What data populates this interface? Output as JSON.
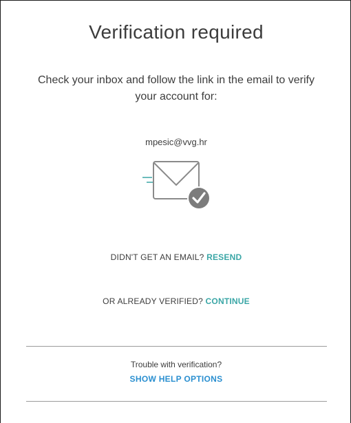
{
  "title": "Verification required",
  "instructions": "Check your inbox and follow the link in the email to verify your account for:",
  "email": "mpesic@vvg.hr",
  "envelope_icon": "envelope-check-icon",
  "resend": {
    "prompt": "DIDN'T GET AN EMAIL?",
    "link_label": "RESEND"
  },
  "continue": {
    "prompt": "OR ALREADY VERIFIED?",
    "link_label": "CONTINUE"
  },
  "help": {
    "prompt": "Trouble with verification?",
    "link_label": "SHOW HELP OPTIONS"
  },
  "colors": {
    "accent_teal": "#3aa6a6",
    "link_blue": "#2a8fd0",
    "text": "#3c3c3c",
    "icon_gray": "#8a8a8a"
  }
}
